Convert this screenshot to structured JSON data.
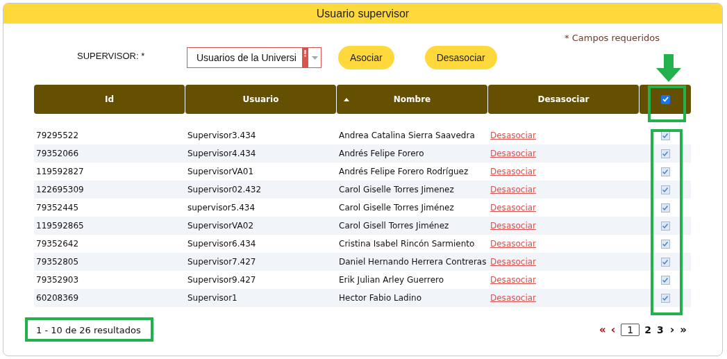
{
  "title": "Usuario supervisor",
  "required_note": "* Campos requeridos",
  "form": {
    "label": "SUPERVISOR: *",
    "select_value": "Usuarios de la Universi",
    "invalid": true
  },
  "buttons": [
    "Asociar",
    "Desasociar"
  ],
  "table": {
    "columns": [
      {
        "label": "Id",
        "sorted": false
      },
      {
        "label": "Usuario",
        "sorted": false
      },
      {
        "label": "Nombre",
        "sorted": true
      },
      {
        "label": "Desasociar",
        "sorted": false
      }
    ],
    "select_all_checked": true,
    "rows": [
      {
        "id": "79295522",
        "user": "Supervisor3.434",
        "name": "Andrea Catalina Sierra Saavedra",
        "action": "Desasociar",
        "checked": true
      },
      {
        "id": "79352066",
        "user": "Supervisor4.434",
        "name": "Andrés Felipe Forero",
        "action": "Desasociar",
        "checked": true
      },
      {
        "id": "119592827",
        "user": "SupervisorVA01",
        "name": "Andrés Felipe Forero Rodríguez",
        "action": "Desasociar",
        "checked": true
      },
      {
        "id": "122695309",
        "user": "Supervisor02.432",
        "name": "Carol Giselle Torres Jimenez",
        "action": "Desasociar",
        "checked": true
      },
      {
        "id": "79352445",
        "user": "supervisor5.434",
        "name": "Carol Giselle Torres Jiménez",
        "action": "Desasociar",
        "checked": true
      },
      {
        "id": "119592865",
        "user": "SupervisorVA02",
        "name": "Carol Gisell Torres Jiménez",
        "action": "Desasociar",
        "checked": true
      },
      {
        "id": "79352642",
        "user": "Supervisor6.434",
        "name": "Cristina Isabel Rincón Sarmiento",
        "action": "Desasociar",
        "checked": true
      },
      {
        "id": "79352805",
        "user": "Supervisor7.427",
        "name": "Daniel Hernando Herrera Contreras",
        "action": "Desasociar",
        "checked": true
      },
      {
        "id": "79352903",
        "user": "Supervisor9.427",
        "name": "Erik Julian Arley Guerrero",
        "action": "Desasociar",
        "checked": true
      },
      {
        "id": "60208369",
        "user": "Supervisor1",
        "name": "Hector Fabio Ladino",
        "action": "Desasociar",
        "checked": true
      }
    ]
  },
  "summary": "1 - 10 de 26 resultados",
  "pagination": [
    {
      "label": "«",
      "kind": "first",
      "disabled": true,
      "selected": false
    },
    {
      "label": "‹",
      "kind": "prev",
      "disabled": true,
      "selected": false
    },
    {
      "label": "1",
      "kind": "page",
      "disabled": false,
      "selected": true
    },
    {
      "label": "2",
      "kind": "page",
      "disabled": false,
      "selected": false
    },
    {
      "label": "3",
      "kind": "page",
      "disabled": false,
      "selected": false
    },
    {
      "label": "›",
      "kind": "next",
      "disabled": false,
      "selected": false
    },
    {
      "label": "»",
      "kind": "last",
      "disabled": false,
      "selected": false
    }
  ]
}
